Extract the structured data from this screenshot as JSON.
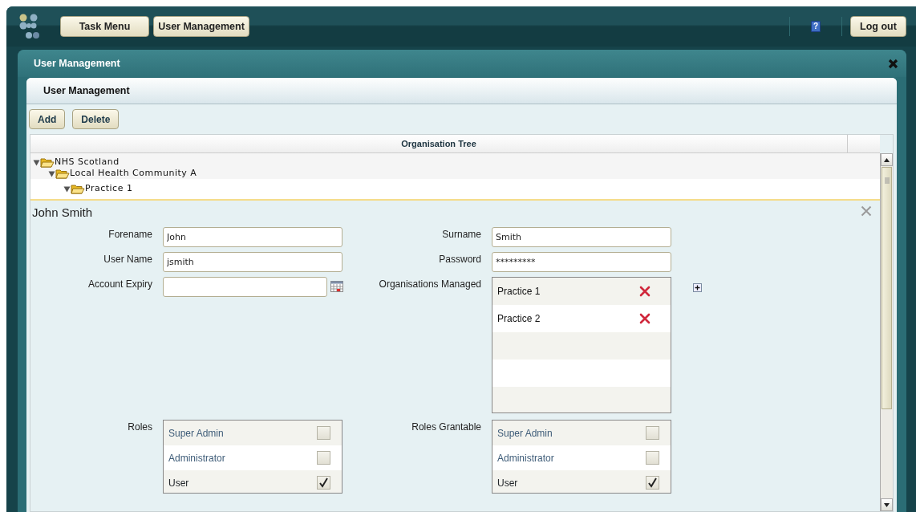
{
  "top_bar": {
    "buttons": [
      "Task Menu",
      "User Management"
    ],
    "help": "?",
    "logout": "Log out"
  },
  "window": {
    "title": "User Management"
  },
  "panel": {
    "title": "User Management",
    "buttons": [
      "Add",
      "Delete"
    ]
  },
  "tree": {
    "heading": "Organisation Tree",
    "nodes": [
      {
        "label": "NHS Scotland",
        "expanded": true,
        "selected": false,
        "children": [
          {
            "label": "Local Health Community A",
            "expanded": true,
            "selected": false,
            "children": [
              {
                "label": "Practice 1",
                "expanded": true,
                "selected": true
              }
            ]
          }
        ]
      }
    ]
  },
  "form": {
    "title": "John Smith",
    "left_fields": [
      {
        "label": "Forename",
        "value": "John"
      },
      {
        "label": "User Name",
        "value": "jsmith"
      },
      {
        "label": "Account Expiry",
        "kind": "date"
      }
    ],
    "right_fields": [
      {
        "label": "Surname",
        "value": "Smith"
      },
      {
        "label": "Password",
        "value": "*********"
      }
    ],
    "organisations_managed": {
      "label": "Organisations Managed",
      "items": [
        "Practice 1",
        "Practice 2"
      ]
    },
    "roles": {
      "label": "Roles",
      "items": [
        {
          "name": "Super Admin",
          "checked": false
        },
        {
          "name": "Administrator",
          "checked": false
        },
        {
          "name": "User",
          "checked": true
        }
      ]
    },
    "roles_grantable": {
      "label": "Roles Grantable",
      "items": [
        {
          "name": "Super Admin",
          "checked": false
        },
        {
          "name": "Administrator",
          "checked": false
        },
        {
          "name": "User",
          "checked": true
        }
      ]
    }
  }
}
